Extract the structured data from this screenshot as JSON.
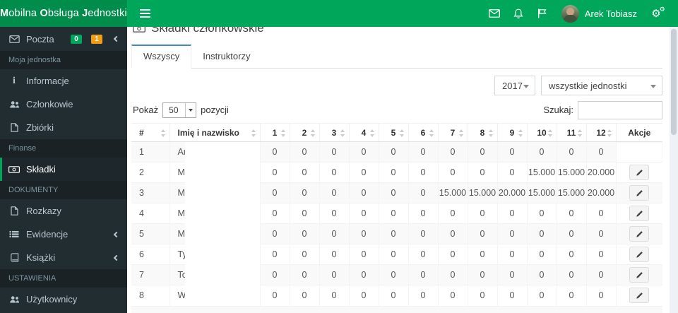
{
  "colors": {
    "navbar": "#00a65a",
    "logo_bg": "#008d4c",
    "sidebar": "#222d32",
    "sidebar_section_bg": "#1a2226",
    "active_accent": "#00a65a",
    "tab_accent": "#3c8dbc",
    "badge_green": "#00a65a",
    "badge_yellow": "#f39c12"
  },
  "icons": {
    "hamburger": "css-bars",
    "envelope": "svg-envelope",
    "bell": "svg-bell",
    "flag": "svg-flag",
    "cogs": "⚙",
    "info": "i",
    "users": "svg-users",
    "file": "svg-file",
    "money": "svg-banknote",
    "list": "svg-list",
    "book": "svg-book",
    "chevron_left": "css-chevron",
    "sort": "css-arrows",
    "pencil": "svg-pencil"
  },
  "navbar": {
    "logo": {
      "b1": "M",
      "t1": "obilna ",
      "b2": "O",
      "t2": "bsługa ",
      "b3": "J",
      "t3": "ednostki"
    },
    "user_name": "Arek Tobiasz"
  },
  "sidebar": {
    "mail": {
      "label": "Poczta",
      "badge_green": "0",
      "badge_yellow": "1"
    },
    "sections": [
      {
        "label": "Moja jednostka",
        "items": [
          {
            "label": "Informacje"
          },
          {
            "label": "Członkowie"
          },
          {
            "label": "Zbiórki"
          }
        ]
      },
      {
        "label": "Finanse",
        "items": [
          {
            "label": "Składki"
          }
        ]
      },
      {
        "label": "DOKUMENTY",
        "items": [
          {
            "label": "Rozkazy"
          },
          {
            "label": "Ewidencje"
          },
          {
            "label": "Książki"
          }
        ]
      },
      {
        "label": "USTAWIENIA",
        "items": [
          {
            "label": "Użytkownicy"
          }
        ]
      }
    ]
  },
  "main": {
    "title": "Składki członkowskie",
    "tabs": [
      {
        "label": "Wszyscy",
        "active": true
      },
      {
        "label": "Instruktorzy",
        "active": false
      }
    ],
    "filters": {
      "year": "2017",
      "unit": "wszystkie jednostki"
    },
    "length_control": {
      "prefix": "Pokaż",
      "value": "50",
      "suffix": "pozycji"
    },
    "search_label": "Szukaj:",
    "table": {
      "headers": [
        "#",
        "Imię i nazwisko",
        "1",
        "2",
        "3",
        "4",
        "5",
        "6",
        "7",
        "8",
        "9",
        "10",
        "11",
        "12",
        "Akcje"
      ],
      "rows": [
        {
          "idx": "1",
          "name": "Arkad",
          "values": [
            "0",
            "0",
            "0",
            "0",
            "0",
            "0",
            "0",
            "0",
            "0",
            "0",
            "0",
            "0"
          ],
          "action": false
        },
        {
          "idx": "2",
          "name": "Mikoła",
          "values": [
            "0",
            "0",
            "0",
            "0",
            "0",
            "0",
            "0",
            "0",
            "0",
            "15.000",
            "15.000",
            "20.000"
          ],
          "action": true
        },
        {
          "idx": "3",
          "name": "Micha",
          "values": [
            "0",
            "0",
            "0",
            "0",
            "0",
            "0",
            "15.000",
            "15.000",
            "20.000",
            "15.000",
            "15.000",
            "20.000"
          ],
          "action": true
        },
        {
          "idx": "4",
          "name": "Micha",
          "values": [
            "0",
            "0",
            "0",
            "0",
            "0",
            "0",
            "0",
            "0",
            "0",
            "0",
            "0",
            "0"
          ],
          "action": true
        },
        {
          "idx": "5",
          "name": "Micha",
          "values": [
            "0",
            "0",
            "0",
            "0",
            "0",
            "0",
            "0",
            "0",
            "0",
            "0",
            "0",
            "0"
          ],
          "action": true
        },
        {
          "idx": "6",
          "name": "Tytus",
          "values": [
            "0",
            "0",
            "0",
            "0",
            "0",
            "0",
            "0",
            "0",
            "0",
            "0",
            "0",
            "0"
          ],
          "action": true
        },
        {
          "idx": "7",
          "name": "Tomas",
          "values": [
            "0",
            "0",
            "0",
            "0",
            "0",
            "0",
            "0",
            "0",
            "0",
            "0",
            "0",
            "0"
          ],
          "action": true
        },
        {
          "idx": "8",
          "name": "Wojcie",
          "values": [
            "0",
            "0",
            "0",
            "0",
            "0",
            "0",
            "0",
            "0",
            "0",
            "0",
            "0",
            "0"
          ],
          "action": true
        }
      ]
    }
  }
}
